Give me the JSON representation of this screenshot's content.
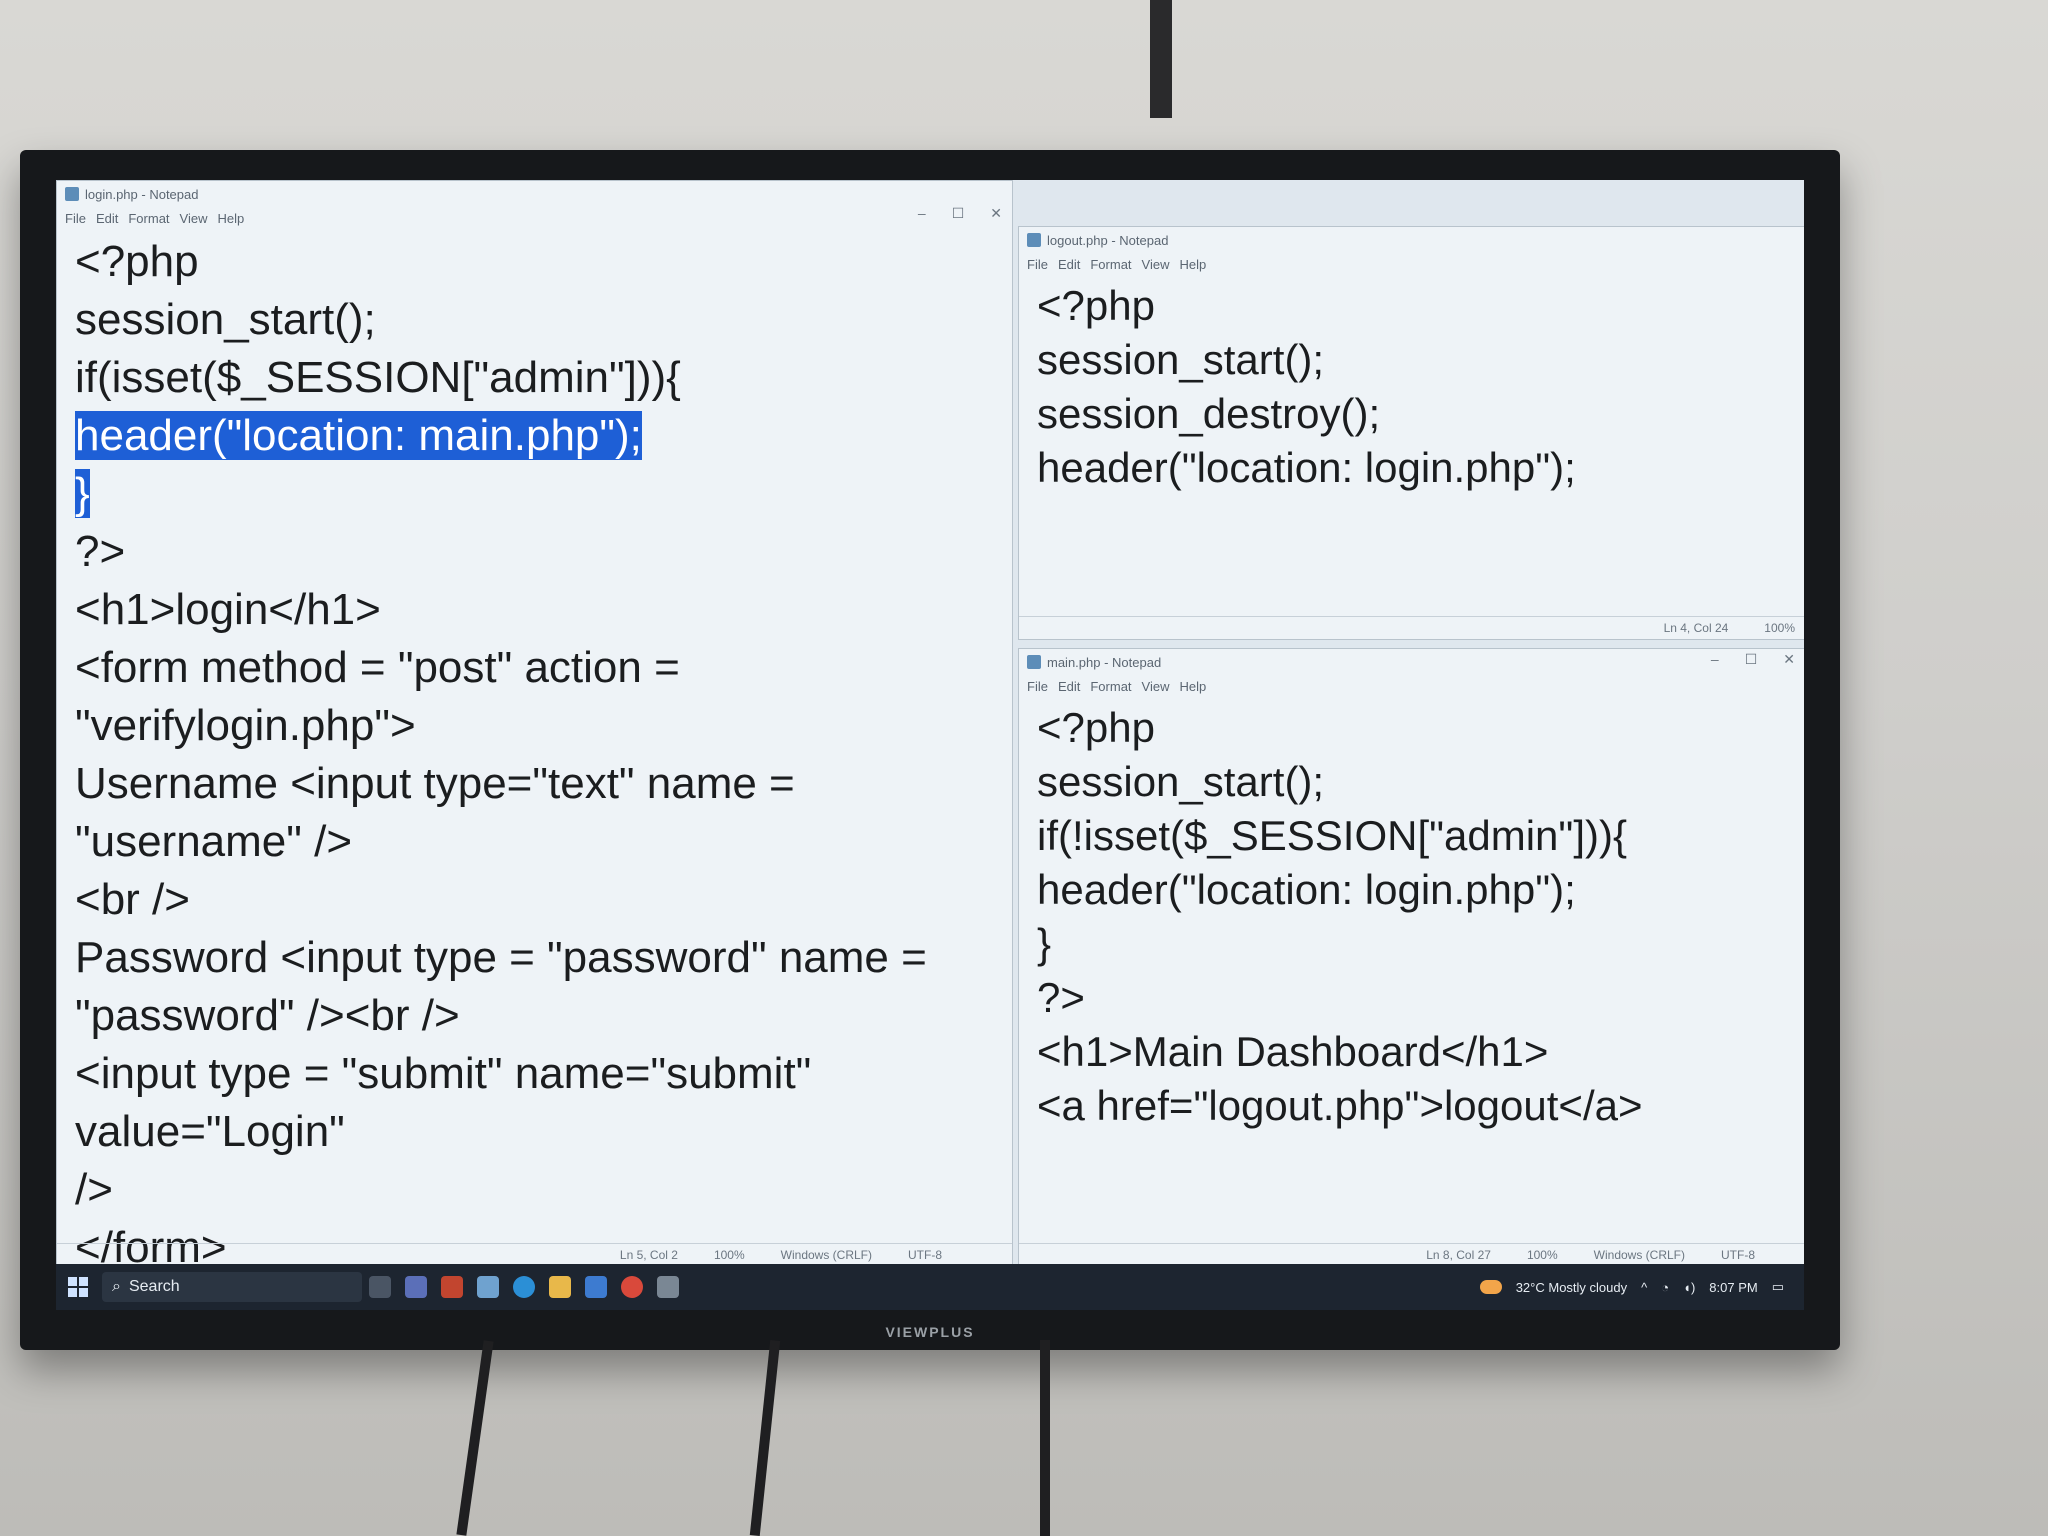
{
  "left_window": {
    "title": "login.php - Notepad",
    "menu": [
      "File",
      "Edit",
      "Format",
      "View",
      "Help"
    ],
    "lines_before": "<?php\nsession_start();\nif(isset($_SESSION[\"admin\"])){\n",
    "selected": "header(\"location: main.php\");\n}",
    "lines_after": "\n?>\n<h1>login</h1>\n<form method = \"post\" action = \"verifylogin.php\">\nUsername <input type=\"text\" name = \"username\" />\n<br />\nPassword <input type = \"password\" name =\n\"password\" /><br />\n<input type = \"submit\" name=\"submit\" value=\"Login\"\n/>\n</form>",
    "status": {
      "position": "Ln 5, Col 2",
      "zoom": "100%",
      "line_ending": "Windows (CRLF)",
      "encoding": "UTF-8"
    }
  },
  "top_right_window": {
    "title": "logout.php - Notepad",
    "menu": [
      "File",
      "Edit",
      "Format",
      "View",
      "Help"
    ],
    "content": "<?php\nsession_start();\nsession_destroy();\nheader(\"location: login.php\");",
    "status": {
      "position": "Ln 4, Col 24",
      "zoom": "100%"
    }
  },
  "bottom_right_window": {
    "title": "main.php - Notepad",
    "menu": [
      "File",
      "Edit",
      "Format",
      "View",
      "Help"
    ],
    "content": "<?php\nsession_start();\nif(!isset($_SESSION[\"admin\"])){\nheader(\"location: login.php\");\n}\n?>\n<h1>Main Dashboard</h1>\n<a href=\"logout.php\">logout</a>",
    "status": {
      "position": "Ln 8, Col 27",
      "zoom": "100%",
      "line_ending": "Windows (CRLF)",
      "encoding": "UTF-8"
    }
  },
  "taskbar": {
    "search_label": "Search",
    "weather": "32°C  Mostly cloudy",
    "time": "8:07 PM"
  },
  "tv_brand": "VIEWPLUS",
  "colors": {
    "selection": "#1e5fd6",
    "taskbar": "#1d2530"
  },
  "icons": [
    "windows-start-icon",
    "search-icon",
    "weather-icon",
    "notification-icon"
  ]
}
